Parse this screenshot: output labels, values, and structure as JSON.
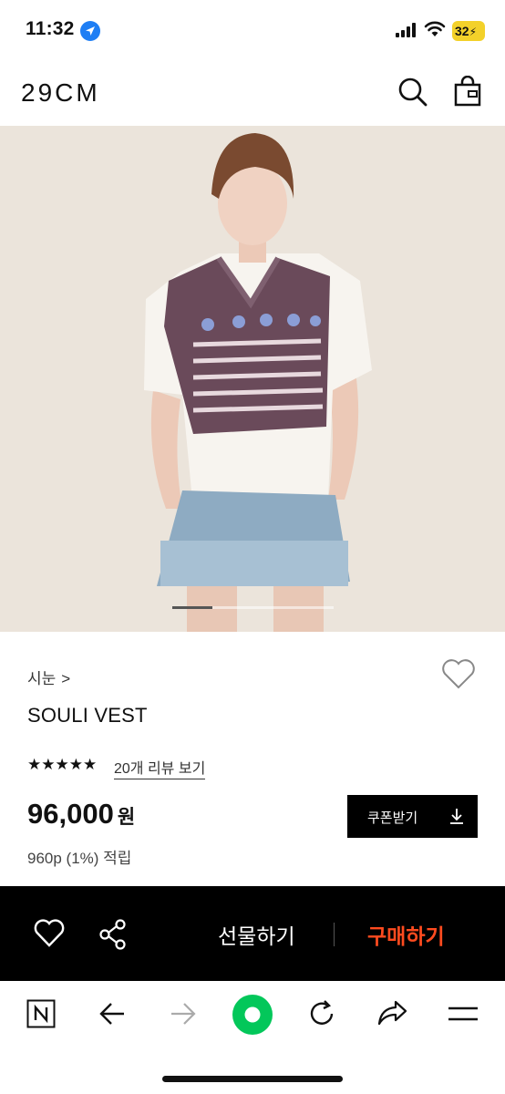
{
  "status_bar": {
    "time": "11:32",
    "battery": "32"
  },
  "header": {
    "logo": "29CM"
  },
  "product": {
    "brand": "시눈",
    "brand_chevron": ">",
    "name": "SOULI VEST",
    "rating_stars": "★★★★★",
    "review_link": "20개 리뷰 보기",
    "price": "96,000",
    "price_unit": "원",
    "points": "960p (1%) 적립",
    "image_page": {
      "current": 1,
      "total": 4
    }
  },
  "coupon": {
    "label": "쿠폰받기"
  },
  "action_bar": {
    "gift_label": "선물하기",
    "buy_label": "구매하기"
  },
  "colors": {
    "buy_accent": "#ff4b1f",
    "naver_green": "#03c75a",
    "background_dark": "#000000"
  },
  "icons": [
    "location-arrow-icon",
    "signal-icon",
    "wifi-icon",
    "search-icon",
    "shopping-bag-icon",
    "heart-icon",
    "share-icon",
    "download-icon",
    "naver-n-icon",
    "back-arrow-icon",
    "forward-arrow-icon",
    "naver-green-dot-icon",
    "refresh-icon",
    "share-arrow-icon",
    "menu-icon"
  ]
}
